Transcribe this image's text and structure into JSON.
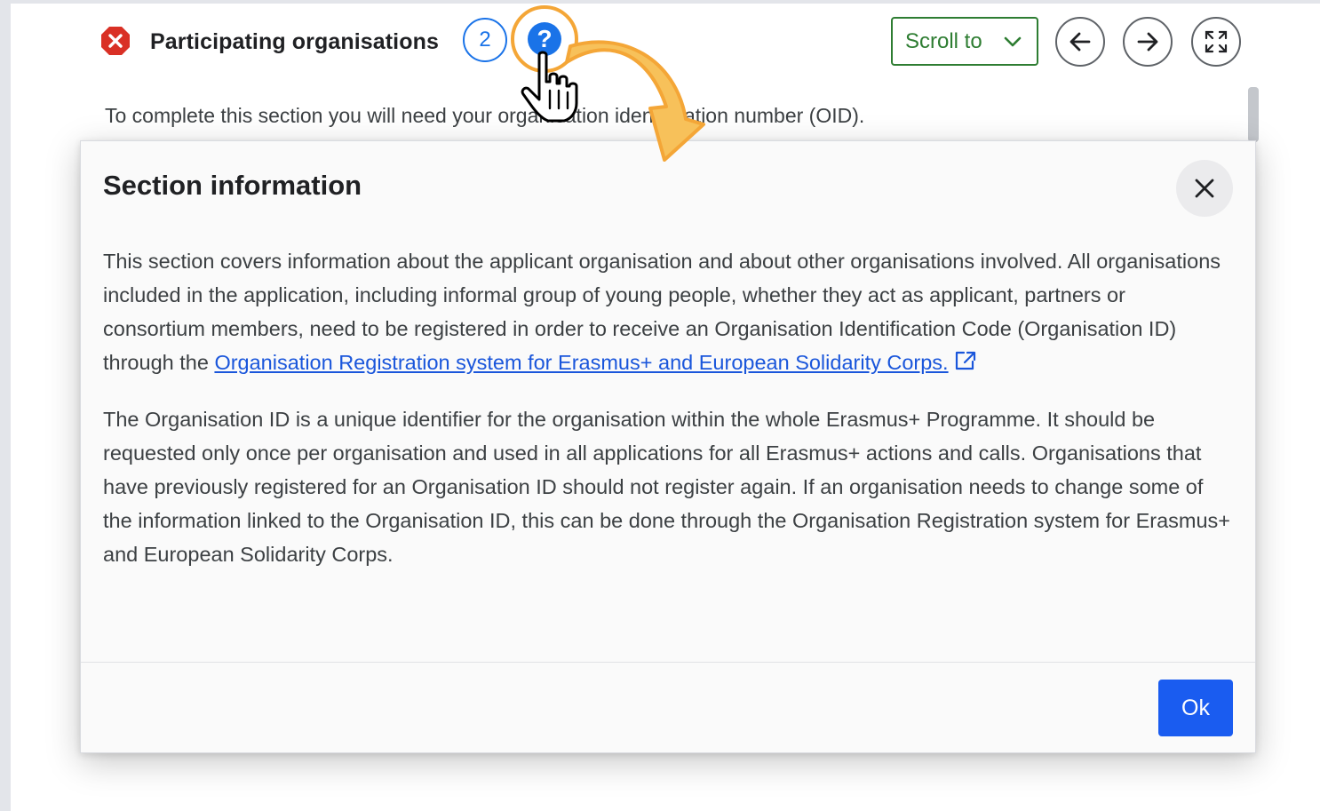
{
  "header": {
    "section_title": "Participating organisations",
    "count_badge": "2",
    "help_symbol": "?",
    "scroll_to_label": "Scroll to",
    "status_icon": "error-x-icon",
    "prev_icon": "arrow-left-icon",
    "next_icon": "arrow-right-icon",
    "expand_icon": "expand-icon"
  },
  "instruction_text": "To complete this section you will need your organisation identification number (OID).",
  "modal": {
    "title": "Section information",
    "paragraph1_before_link": "This section covers information about the applicant organisation and about other organisations involved. All organisations included in the application, including informal group of young people, whether they act as applicant, partners or consortium members, need to be registered in order to receive an Organisation Identification Code (Organisation ID) through the ",
    "paragraph1_link": "Organisation Registration system for Erasmus+ and European Solidarity Corps.",
    "paragraph2": "The Organisation ID is a unique identifier for the organisation within the whole Erasmus+ Programme. It should be requested only once per organisation and used in all applications for all Erasmus+ actions and calls. Organisations that have previously registered for an Organisation ID should not register again. If an organisation needs to change some of the information linked to the Organisation ID, this can be done through the Organisation Registration system for Erasmus+ and European Solidarity Corps.",
    "ok_label": "Ok",
    "close_icon": "close-icon",
    "link_icon": "external-link-icon"
  },
  "colors": {
    "primary_blue": "#1a73e8",
    "ok_button": "#1a5cf0",
    "link": "#1a56db",
    "scroll_green": "#2e7d32",
    "error_red": "#d93025",
    "highlight_orange": "#f4a637"
  }
}
